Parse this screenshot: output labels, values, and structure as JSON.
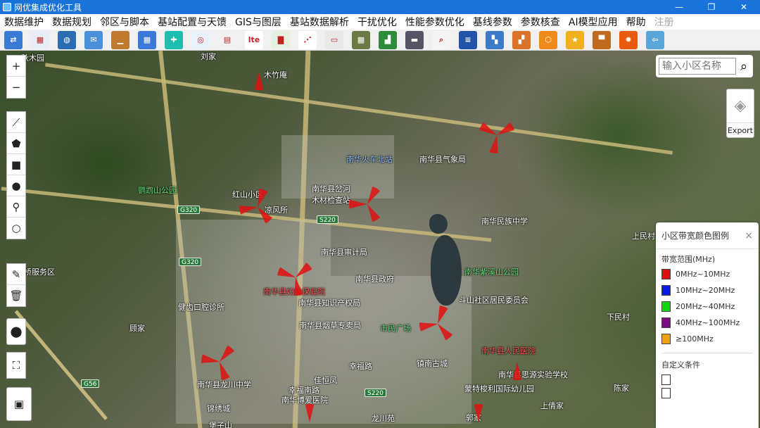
{
  "window": {
    "title": "网优集成优化工具",
    "buttons": [
      "—",
      "❐",
      "✕"
    ]
  },
  "menu": [
    "数据维护",
    "数据规划",
    "邻区与脚本",
    "基站配置与天馈",
    "GIS与图层",
    "基站数据解析",
    "干扰优化",
    "性能参数优化",
    "基线参数",
    "参数核查",
    "AI模型应用",
    "帮助",
    "注册"
  ],
  "toolbar": {
    "icons": [
      {
        "name": "network-config-icon",
        "color": "#3a7bd5",
        "glyph": "⇄"
      },
      {
        "name": "table-icon",
        "color": "#e8eef7",
        "glyph": "▦"
      },
      {
        "name": "globe-icon",
        "color": "#2a6db0",
        "glyph": "◍"
      },
      {
        "name": "mail-icon",
        "color": "#4a90d9",
        "glyph": "✉"
      },
      {
        "name": "landscape-icon",
        "color": "#c07a30",
        "glyph": "▁"
      },
      {
        "name": "calculator-icon",
        "color": "#3b78d8",
        "glyph": "▦"
      },
      {
        "name": "plugin-icon",
        "color": "#1fbfae",
        "glyph": "✚"
      },
      {
        "name": "china-mobile-icon",
        "color": "#e9f2fb",
        "glyph": "◎"
      },
      {
        "name": "document-icon",
        "color": "#f2f2f2",
        "glyph": "▤"
      },
      {
        "name": "lte-icon",
        "color": "#ffffff",
        "glyph": "lte"
      },
      {
        "name": "bar-chart-icon",
        "color": "#e6f0e0",
        "glyph": "▇"
      },
      {
        "name": "nodes-icon",
        "color": "#ffffff",
        "glyph": "⋰"
      },
      {
        "name": "server-icon",
        "color": "#e8e8e8",
        "glyph": "▭"
      },
      {
        "name": "map-tile-icon",
        "color": "#6b7a44",
        "glyph": "▦"
      },
      {
        "name": "chart-map-icon",
        "color": "#2e8b3a",
        "glyph": "▟"
      },
      {
        "name": "device-icon",
        "color": "#556",
        "glyph": "▬"
      },
      {
        "name": "search-doc-icon",
        "color": "#f5f5f5",
        "glyph": "⌕"
      },
      {
        "name": "report-icon",
        "color": "#2255aa",
        "glyph": "≡"
      },
      {
        "name": "heatmap-icon",
        "color": "#3d7ac8",
        "glyph": "▚"
      },
      {
        "name": "coverage-icon",
        "color": "#d9732a",
        "glyph": "▞"
      },
      {
        "name": "hexagon-icon",
        "color": "#f08a1a",
        "glyph": "⬡"
      },
      {
        "name": "star-icon",
        "color": "#f0b020",
        "glyph": "★"
      },
      {
        "name": "image-icon",
        "color": "#c06a20",
        "glyph": "▀"
      },
      {
        "name": "fire-icon",
        "color": "#e85a10",
        "glyph": "✹"
      },
      {
        "name": "exit-icon",
        "color": "#5aa6d8",
        "glyph": "⇦"
      }
    ]
  },
  "map": {
    "search": {
      "placeholder": "输入小区名称"
    },
    "layers": {
      "label": "Export"
    },
    "labels": [
      {
        "text": "秋木园",
        "cls": ""
      },
      {
        "text": "刘家",
        "cls": ""
      },
      {
        "text": "木竹庵",
        "cls": ""
      },
      {
        "text": "南华火车北站",
        "cls": "blue"
      },
      {
        "text": "南华县气象局",
        "cls": ""
      },
      {
        "text": "鹦鹉山公园",
        "cls": "green"
      },
      {
        "text": "红山小区",
        "cls": ""
      },
      {
        "text": "凉风所",
        "cls": ""
      },
      {
        "text": "南华县岔河",
        "cls": ""
      },
      {
        "text": "木材检查站",
        "cls": ""
      },
      {
        "text": "南华民族中学",
        "cls": ""
      },
      {
        "text": "南华县审计局",
        "cls": ""
      },
      {
        "text": "南华县政府",
        "cls": ""
      },
      {
        "text": "南华紫溪山公园",
        "cls": "green"
      },
      {
        "text": "桥服务区",
        "cls": ""
      },
      {
        "text": "南华县妇幼保健院",
        "cls": "red"
      },
      {
        "text": "南华县知识产权局",
        "cls": ""
      },
      {
        "text": "斗山社区居民委员会",
        "cls": ""
      },
      {
        "text": "健齿口腔诊所",
        "cls": ""
      },
      {
        "text": "南华县烟草专卖局",
        "cls": ""
      },
      {
        "text": "市民广场",
        "cls": "green"
      },
      {
        "text": "顾家",
        "cls": ""
      },
      {
        "text": "南华县人民医院",
        "cls": "red"
      },
      {
        "text": "幸福路",
        "cls": ""
      },
      {
        "text": "镇南古城",
        "cls": ""
      },
      {
        "text": "南华县思源实验学校",
        "cls": ""
      },
      {
        "text": "南华县龙川中学",
        "cls": ""
      },
      {
        "text": "蒙特梭利国际幼儿园",
        "cls": ""
      },
      {
        "text": "南华博爱医院",
        "cls": ""
      },
      {
        "text": "上民村",
        "cls": ""
      },
      {
        "text": "下民村",
        "cls": ""
      },
      {
        "text": "陈家",
        "cls": ""
      },
      {
        "text": "上倩家",
        "cls": ""
      },
      {
        "text": "郭家",
        "cls": ""
      },
      {
        "text": "锦绣城",
        "cls": ""
      },
      {
        "text": "堡子山",
        "cls": ""
      },
      {
        "text": "龙川苑",
        "cls": ""
      },
      {
        "text": "佳恒凤",
        "cls": ""
      },
      {
        "text": "幸福南路",
        "cls": ""
      }
    ],
    "roads": [
      "G320",
      "S220",
      "G320",
      "S220",
      "G56"
    ]
  },
  "legend": {
    "title": "小区带宽颜色图例",
    "close": "×",
    "section": "带宽范围(MHz)",
    "items": [
      {
        "label": "0MHz~10MHz",
        "color": "#e01010"
      },
      {
        "label": "10MHz~20MHz",
        "color": "#0a18e8"
      },
      {
        "label": "20MHz~40MHz",
        "color": "#12d412"
      },
      {
        "label": "40MHz~100MHz",
        "color": "#7a0a86"
      },
      {
        "label": "≥100MHz",
        "color": "#f0a010"
      }
    ],
    "custom": "自定义条件"
  }
}
